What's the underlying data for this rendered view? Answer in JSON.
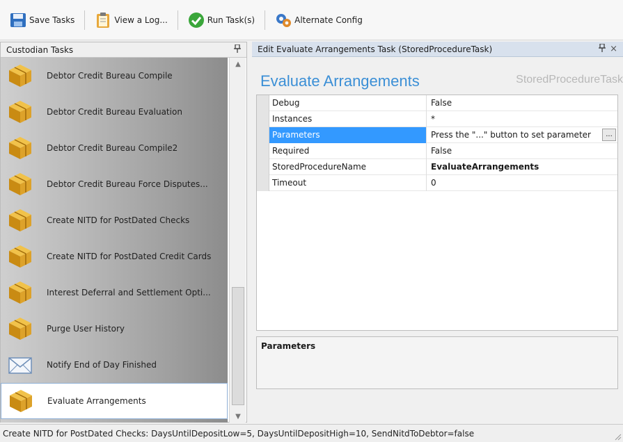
{
  "toolbar": {
    "save_label": "Save Tasks",
    "view_log_label": "View a Log...",
    "run_label": "Run Task(s)",
    "alt_config_label": "Alternate Config"
  },
  "left_panel": {
    "title": "Custodian Tasks",
    "pin_glyph": "⬇",
    "tasks": [
      {
        "label": "Debtor Credit Bureau Compile",
        "icon": "box-icon"
      },
      {
        "label": "Debtor Credit Bureau Evaluation",
        "icon": "box-icon"
      },
      {
        "label": "Debtor Credit Bureau Compile2",
        "icon": "box-icon"
      },
      {
        "label": "Debtor Credit Bureau Force Disputes...",
        "icon": "box-icon"
      },
      {
        "label": "Create NITD for PostDated Checks",
        "icon": "box-icon"
      },
      {
        "label": "Create NITD for PostDated Credit Cards",
        "icon": "box-icon"
      },
      {
        "label": "Interest Deferral and Settlement Opti...",
        "icon": "box-icon"
      },
      {
        "label": "Purge User History",
        "icon": "box-icon"
      },
      {
        "label": "Notify End of Day Finished",
        "icon": "envelope-icon"
      },
      {
        "label": "Evaluate Arrangements",
        "icon": "box-icon"
      }
    ]
  },
  "right_panel": {
    "header": "Edit Evaluate Arrangements Task (StoredProcedureTask)",
    "pin_glyph": "⬇",
    "close_glyph": "×",
    "task_title": "Evaluate Arrangements",
    "task_type": "StoredProcedureTask",
    "properties": [
      {
        "name": "Debug",
        "value": "False"
      },
      {
        "name": "Instances",
        "value": "*"
      },
      {
        "name": "Parameters",
        "value": "Press the \"...\" button to set parameter",
        "selected": true
      },
      {
        "name": "Required",
        "value": "False"
      },
      {
        "name": "StoredProcedureName",
        "value": "EvaluateArrangements",
        "bold": true
      },
      {
        "name": "Timeout",
        "value": "0"
      }
    ],
    "ellipsis_label": "...",
    "description_title": "Parameters"
  },
  "status_bar": {
    "text": "Create NITD for PostDated Checks: DaysUntilDepositLow=5, DaysUntilDepositHigh=10, SendNitdToDebtor=false"
  },
  "colors": {
    "accent_title": "#3b8fd6",
    "selection": "#3399ff",
    "header_blue": "#d8e1ed",
    "box_gold": "#d9a520"
  }
}
